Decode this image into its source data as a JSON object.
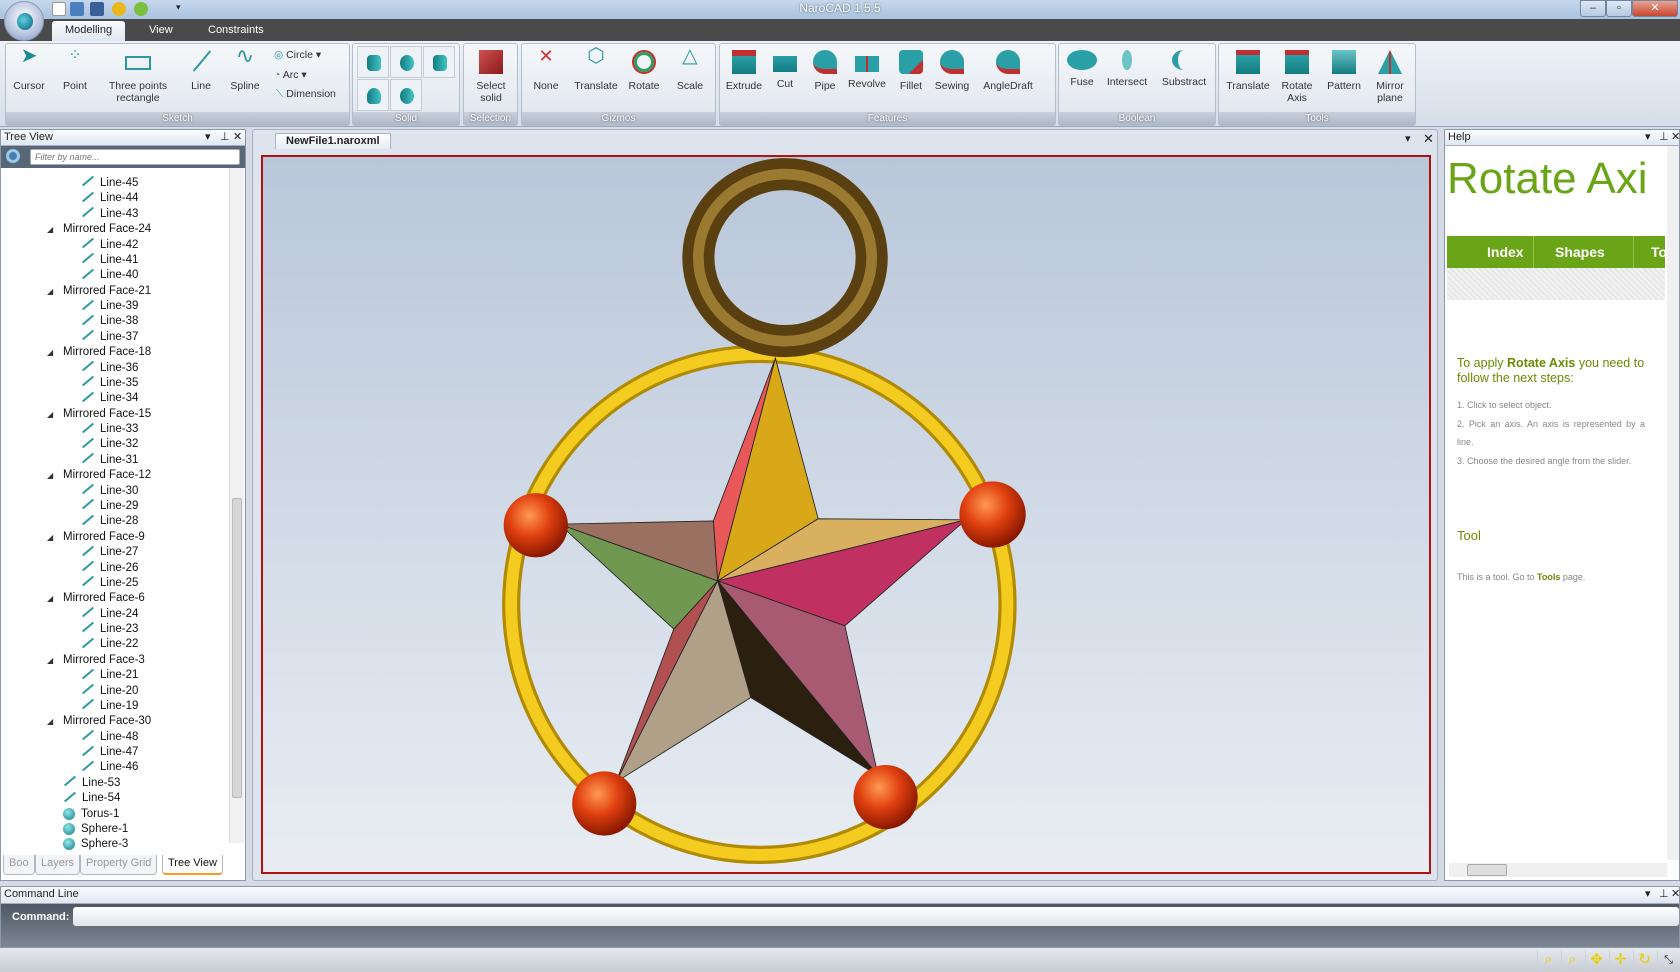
{
  "app": {
    "title": "NaroCAD 1.5.5",
    "tabs": [
      "Modelling",
      "View",
      "Constraints"
    ],
    "active_tab": "Modelling"
  },
  "ribbon": {
    "sketch": {
      "label": "Sketch",
      "items": [
        "Cursor",
        "Point",
        "Three points\nrectangle",
        "Line",
        "Spline"
      ],
      "small": [
        "Circle",
        "Arc",
        "Dimension"
      ]
    },
    "solid": {
      "label": "Solid"
    },
    "selection": {
      "label": "Selection",
      "item": "Select\nsolid"
    },
    "gizmos": {
      "label": "Gizmos",
      "items": [
        "None",
        "Translate",
        "Rotate",
        "Scale"
      ]
    },
    "features": {
      "label": "Features",
      "items": [
        "Extrude",
        "Cut",
        "Pipe",
        "Revolve",
        "Fillet",
        "Sewing",
        "AngleDraft"
      ]
    },
    "boolean": {
      "label": "Boolean",
      "items": [
        "Fuse",
        "Intersect",
        "Substract"
      ]
    },
    "tools": {
      "label": "Tools",
      "items": [
        "Translate",
        "Rotate\nAxis",
        "Pattern",
        "Mirror\nplane"
      ]
    }
  },
  "tree": {
    "title": "Tree View",
    "filter_placeholder": "Filter by name...",
    "rows": [
      {
        "l": 2,
        "t": "Line-45"
      },
      {
        "l": 2,
        "t": "Line-44"
      },
      {
        "l": 2,
        "t": "Line-43"
      },
      {
        "l": 1,
        "t": "Mirrored Face-24"
      },
      {
        "l": 2,
        "t": "Line-42"
      },
      {
        "l": 2,
        "t": "Line-41"
      },
      {
        "l": 2,
        "t": "Line-40"
      },
      {
        "l": 1,
        "t": "Mirrored Face-21"
      },
      {
        "l": 2,
        "t": "Line-39"
      },
      {
        "l": 2,
        "t": "Line-38"
      },
      {
        "l": 2,
        "t": "Line-37"
      },
      {
        "l": 1,
        "t": "Mirrored Face-18"
      },
      {
        "l": 2,
        "t": "Line-36"
      },
      {
        "l": 2,
        "t": "Line-35"
      },
      {
        "l": 2,
        "t": "Line-34"
      },
      {
        "l": 1,
        "t": "Mirrored Face-15"
      },
      {
        "l": 2,
        "t": "Line-33"
      },
      {
        "l": 2,
        "t": "Line-32"
      },
      {
        "l": 2,
        "t": "Line-31"
      },
      {
        "l": 1,
        "t": "Mirrored Face-12"
      },
      {
        "l": 2,
        "t": "Line-30"
      },
      {
        "l": 2,
        "t": "Line-29"
      },
      {
        "l": 2,
        "t": "Line-28"
      },
      {
        "l": 1,
        "t": "Mirrored Face-9"
      },
      {
        "l": 2,
        "t": "Line-27"
      },
      {
        "l": 2,
        "t": "Line-26"
      },
      {
        "l": 2,
        "t": "Line-25"
      },
      {
        "l": 1,
        "t": "Mirrored Face-6"
      },
      {
        "l": 2,
        "t": "Line-24"
      },
      {
        "l": 2,
        "t": "Line-23"
      },
      {
        "l": 2,
        "t": "Line-22"
      },
      {
        "l": 1,
        "t": "Mirrored Face-3"
      },
      {
        "l": 2,
        "t": "Line-21"
      },
      {
        "l": 2,
        "t": "Line-20"
      },
      {
        "l": 2,
        "t": "Line-19"
      },
      {
        "l": 1,
        "t": "Mirrored Face-30"
      },
      {
        "l": 2,
        "t": "Line-48"
      },
      {
        "l": 2,
        "t": "Line-47"
      },
      {
        "l": 2,
        "t": "Line-46"
      },
      {
        "l": 0,
        "t": "Line-53"
      },
      {
        "l": 0,
        "t": "Line-54"
      },
      {
        "l": 0,
        "t": "Torus-1",
        "ball": true
      },
      {
        "l": 0,
        "t": "Sphere-1",
        "ball": true
      },
      {
        "l": 0,
        "t": "Sphere-3",
        "ball": true
      }
    ],
    "bottom_tabs": [
      "Boo",
      "Layers",
      "Property Grid",
      "Tree View"
    ],
    "active_bottom_tab": "Tree View"
  },
  "document": {
    "tab": "NewFile1.naroxml"
  },
  "help": {
    "title": "Help",
    "heading": "Rotate Axi",
    "nav": [
      "Index",
      "Shapes",
      "To"
    ],
    "intro_pre": "To apply ",
    "intro_bold": "Rotate Axis",
    "intro_post": " you need to follow the next steps:",
    "steps": [
      "1. Click to select object.",
      "2. Pick an axis. An axis is represented by a line.",
      "3. Choose the desired angle from the slider."
    ],
    "tool_heading": "Tool",
    "tool_pre": "This is a tool. Go to ",
    "tool_link": "Tools",
    "tool_post": " page."
  },
  "command": {
    "title": "Command Line",
    "label": "Command:",
    "value": ""
  },
  "colors": {
    "accent_green": "#6aa517",
    "viewport_border": "#b31010",
    "gold": "#f0c419",
    "sphere": "#e04010"
  }
}
